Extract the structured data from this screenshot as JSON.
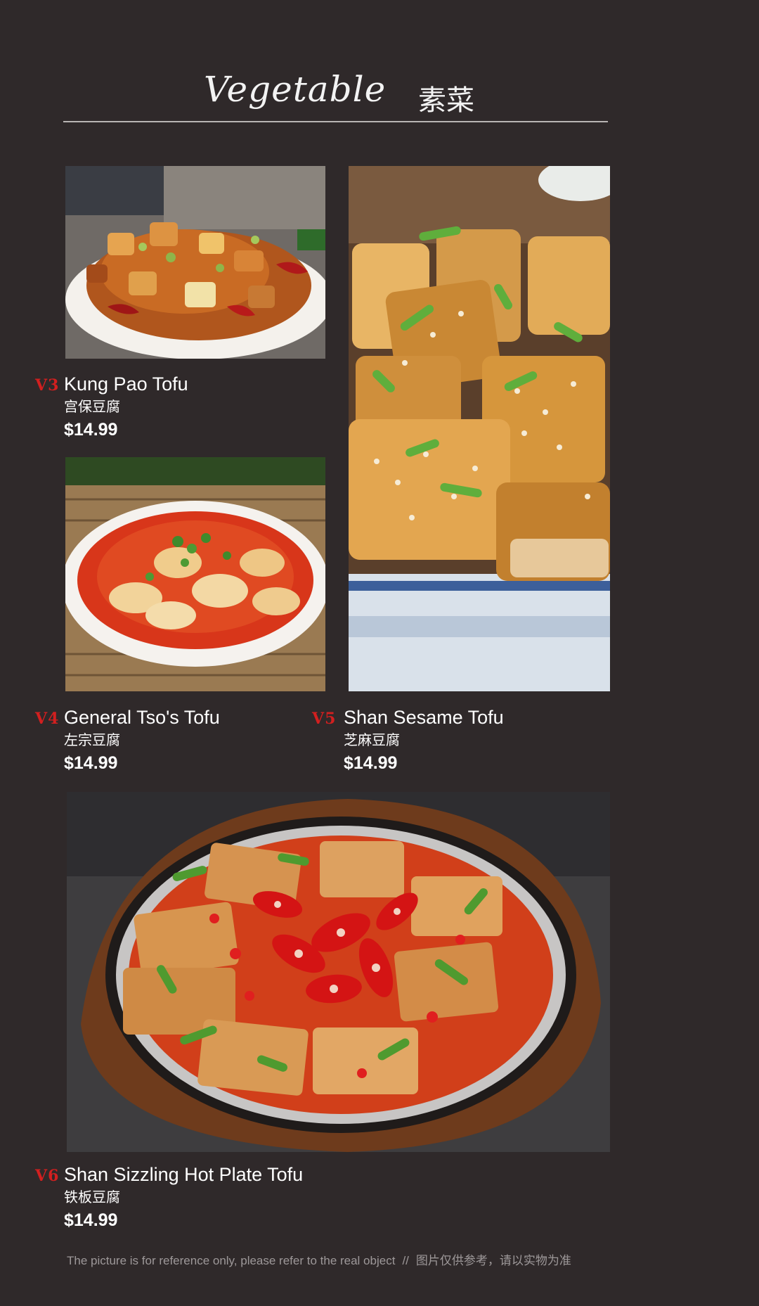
{
  "header": {
    "title_en": "Vegetable",
    "title_zh": "素菜"
  },
  "items": [
    {
      "code": "V3",
      "name": "Kung Pao Tofu",
      "name_zh": "宫保豆腐",
      "price": "$14.99"
    },
    {
      "code": "V4",
      "name": "General Tso's Tofu",
      "name_zh": "左宗豆腐",
      "price": "$14.99"
    },
    {
      "code": "V5",
      "name": "Shan Sesame Tofu",
      "name_zh": "芝麻豆腐",
      "price": "$14.99"
    },
    {
      "code": "V6",
      "name": "Shan Sizzling Hot Plate Tofu",
      "name_zh": "铁板豆腐",
      "price": "$14.99"
    }
  ],
  "footer": {
    "note_en": "The picture is for reference only, please refer to the real object",
    "separator": "//",
    "note_zh": "图片仅供参考，请以实物为准"
  },
  "colors": {
    "background": "#2f292a",
    "code_red": "#d21f1f",
    "text": "#ffffff",
    "rule": "#b9b5b4"
  }
}
